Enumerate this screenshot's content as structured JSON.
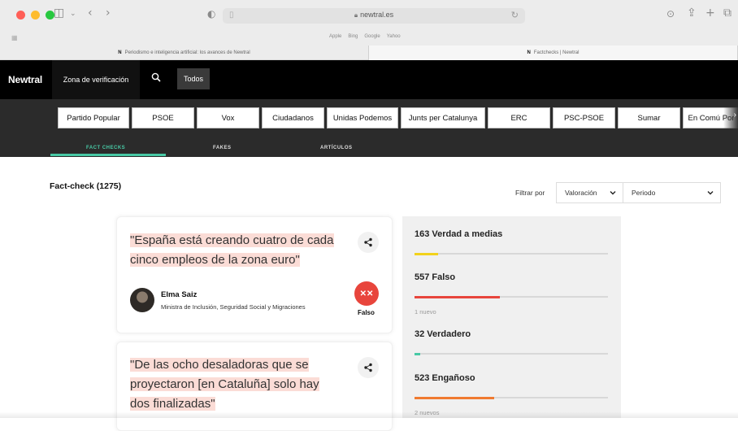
{
  "browser": {
    "url": "newtral.es",
    "favorites": [
      "Apple",
      "Bing",
      "Google",
      "Yahoo"
    ],
    "tabs": [
      {
        "title": "Periodismo e inteligencia artificial: los avances de Newtral",
        "active": false
      },
      {
        "title": "Factchecks | Newtral",
        "active": true
      }
    ],
    "traffic_colors": [
      "#ff5f57",
      "#febc2e",
      "#28c840"
    ]
  },
  "header": {
    "logo": "Newtral",
    "zona_label": "Zona de verificación",
    "todos_label": "Todos"
  },
  "parties": [
    "Partido Popular",
    "PSOE",
    "Vox",
    "Ciudadanos",
    "Unidas Podemos",
    "Junts per Catalunya",
    "ERC",
    "PSC-PSOE",
    "Sumar",
    "En Comú Por"
  ],
  "section_tabs": {
    "fact_checks": "FACT CHECKS",
    "fakes": "FAKES",
    "articulos": "ARTÍCULOS"
  },
  "content": {
    "count_title": "Fact-check (1275)",
    "filter_label": "Filtrar por",
    "valoracion": "Valoración",
    "periodo": "Periodo"
  },
  "cards": [
    {
      "quote_lines": [
        "\"España está creando cuatro de cada",
        "cinco empleos de la zona euro\""
      ],
      "author": "Elma Saiz",
      "role": "Ministra de Inclusión, Seguridad Social y Migraciones",
      "verdict": "Falso",
      "verdict_icon": "x-x-icon"
    },
    {
      "quote_lines": [
        "\"De las ocho desaladoras que se",
        "proyectaron [en Cataluña] solo hay",
        "dos finalizadas\""
      ]
    }
  ],
  "stats": [
    {
      "label": "163 Verdad a medias",
      "fraction": 0.12,
      "color": "#f2d21b",
      "note": ""
    },
    {
      "label": "557 Falso",
      "fraction": 0.44,
      "color": "#e8453c",
      "note": "1 nuevo"
    },
    {
      "label": "32 Verdadero",
      "fraction": 0.03,
      "color": "#48c9a5",
      "note": ""
    },
    {
      "label": "523 Engañoso",
      "fraction": 0.41,
      "color": "#f07a30",
      "note": "2 nuevos"
    }
  ]
}
